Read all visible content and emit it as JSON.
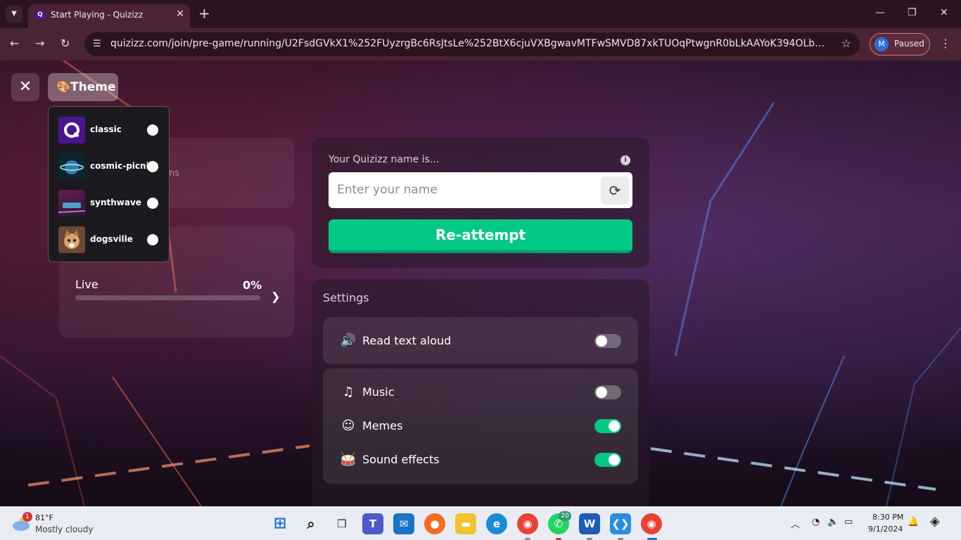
{
  "browser": {
    "tab_title": "Start Playing - Quizizz",
    "tab_favicon_letter": "Q",
    "url": "quizizz.com/join/pre-game/running/U2FsdGVkX1%252FUyzrgBc6RsJtsLe%252BtX6cjuVXBgwavMTFwSMVD87xkTUOqPtwgnR0bLkAAYoK394OLbzWeZ9BCHQ%253D...",
    "profile_initial": "M",
    "profile_status": "Paused",
    "icons": [
      "chevron-down-icon",
      "close-icon",
      "plus-icon",
      "minimize-icon",
      "restore-icon",
      "back-icon",
      "forward-icon",
      "reload-icon",
      "site-info-icon",
      "star-icon",
      "kebab-menu-icon"
    ]
  },
  "quiz": {
    "theme_button_label": "Theme",
    "theme_options": [
      {
        "name": "classic",
        "thumb_color": "#46178f"
      },
      {
        "name": "cosmic-picnic",
        "thumb_color": "#0e2430"
      },
      {
        "name": "synthwave",
        "thumb_color": "#3a1236"
      },
      {
        "name": "dogsville",
        "thumb_color": "#6a4a34"
      }
    ],
    "card_partial_text": "ns",
    "live_label": "Live",
    "live_percent": "0%",
    "live_progress": 0,
    "name_prompt": "Your Quizizz name is...",
    "name_placeholder": "Enter your name",
    "reattempt_label": "Re-attempt",
    "settings_title": "Settings",
    "settings": [
      {
        "label": "Read text aloud",
        "icon": "speaker-icon",
        "on": false
      },
      {
        "label": "Music",
        "icon": "music-note-icon",
        "on": false
      },
      {
        "label": "Memes",
        "icon": "laughing-face-icon",
        "on": true
      },
      {
        "label": "Sound effects",
        "icon": "drum-icon",
        "on": true
      }
    ],
    "accent_color": "#00c985"
  },
  "taskbar": {
    "weather_badge": "1",
    "weather_temp": "81°F",
    "weather_desc": "Mostly cloudy",
    "whatsapp_badge": "20",
    "clock_time": "8:30 PM",
    "clock_date": "9/1/2024",
    "apps": [
      "windows-start-icon",
      "search-icon",
      "task-view-icon",
      "teams-icon",
      "mail-icon",
      "firefox-icon",
      "file-explorer-icon",
      "edge-icon",
      "chrome-icon",
      "whatsapp-icon",
      "word-icon",
      "vscode-icon",
      "chrome-profile-icon"
    ]
  }
}
